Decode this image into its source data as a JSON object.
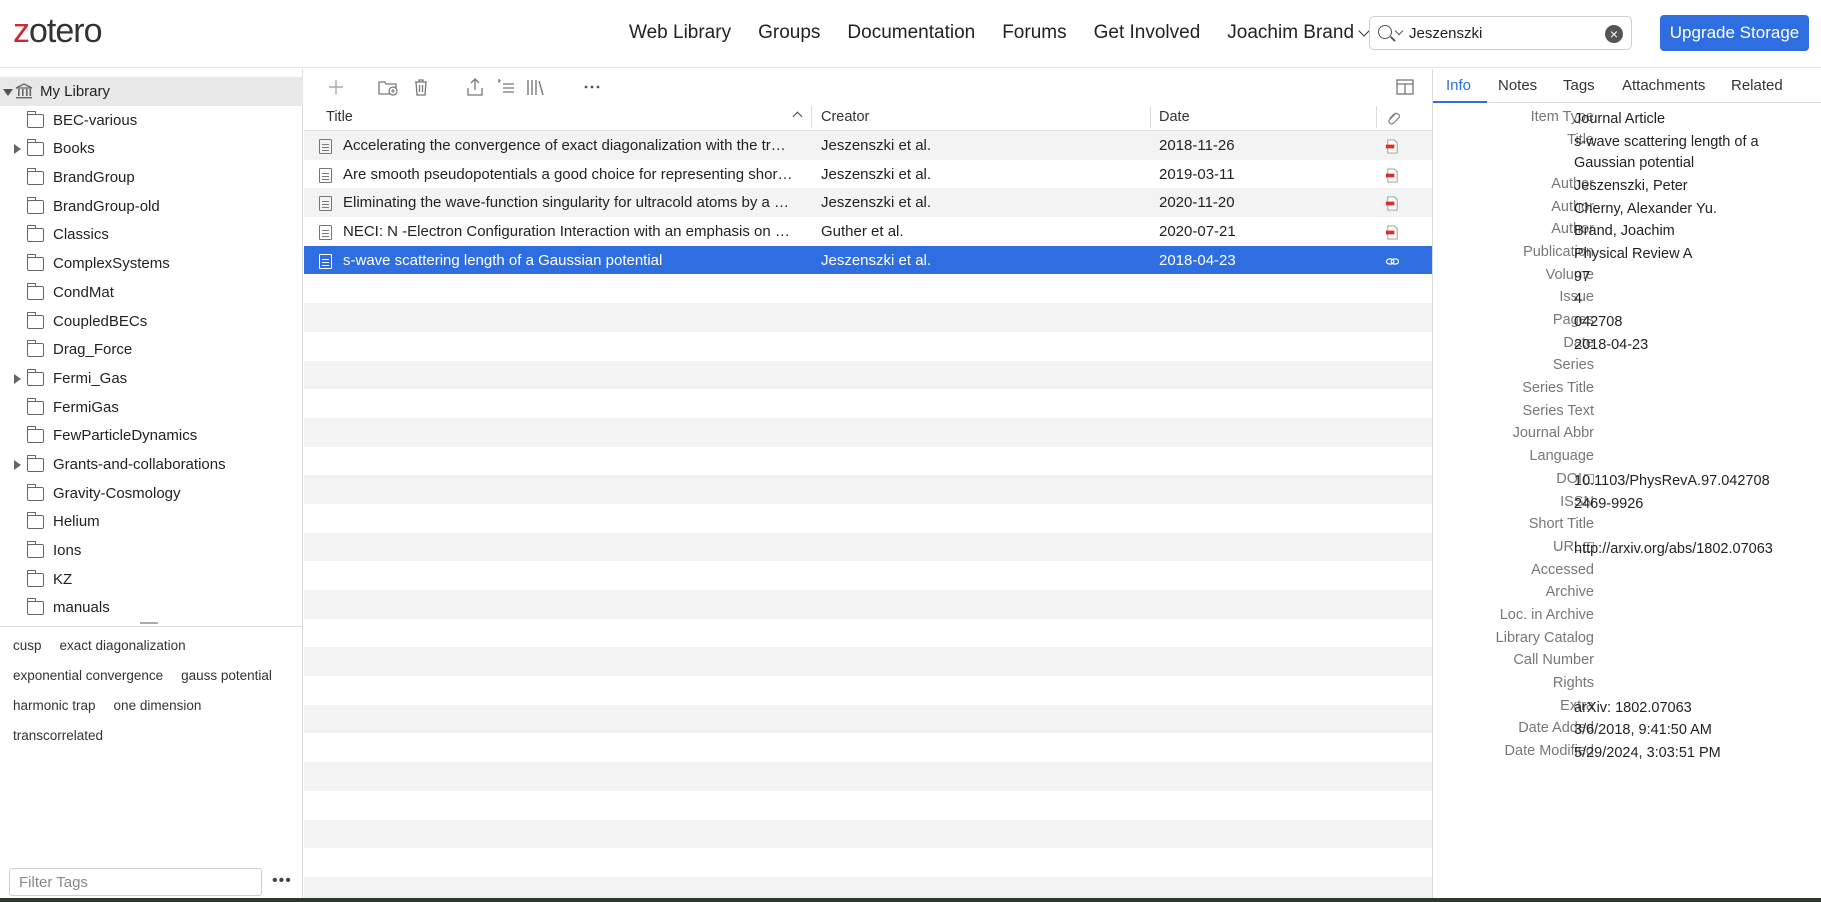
{
  "header": {
    "logo": "zotero",
    "nav": [
      "Web Library",
      "Groups",
      "Documentation",
      "Forums",
      "Get Involved"
    ],
    "user_name": "Joachim Brand",
    "search_value": "Jeszenszki",
    "upgrade_label": "Upgrade Storage"
  },
  "sidebar": {
    "root_label": "My Library",
    "collections": [
      {
        "label": "BEC-various",
        "expandable": false
      },
      {
        "label": "Books",
        "expandable": true
      },
      {
        "label": "BrandGroup",
        "expandable": false
      },
      {
        "label": "BrandGroup-old",
        "expandable": false
      },
      {
        "label": "Classics",
        "expandable": false
      },
      {
        "label": "ComplexSystems",
        "expandable": false
      },
      {
        "label": "CondMat",
        "expandable": false
      },
      {
        "label": "CoupledBECs",
        "expandable": false
      },
      {
        "label": "Drag_Force",
        "expandable": false
      },
      {
        "label": "Fermi_Gas",
        "expandable": true
      },
      {
        "label": "FermiGas",
        "expandable": false
      },
      {
        "label": "FewParticleDynamics",
        "expandable": false
      },
      {
        "label": "Grants-and-collaborations",
        "expandable": true
      },
      {
        "label": "Gravity-Cosmology",
        "expandable": false
      },
      {
        "label": "Helium",
        "expandable": false
      },
      {
        "label": "Ions",
        "expandable": false
      },
      {
        "label": "KZ",
        "expandable": false
      },
      {
        "label": "manuals",
        "expandable": false
      }
    ],
    "tags": [
      "cusp",
      "exact diagonalization",
      "exponential convergence",
      "gauss potential",
      "harmonic trap",
      "one dimension",
      "transcorrelated"
    ],
    "filter_placeholder": "Filter Tags",
    "more_label": "•••"
  },
  "toolbar": {
    "icons": [
      "add-icon",
      "new-collection-icon",
      "trash-icon",
      "export-icon",
      "citation-icon",
      "library-icon",
      "more-icon",
      "columns-icon"
    ]
  },
  "table": {
    "columns": {
      "title": "Title",
      "creator": "Creator",
      "date": "Date"
    },
    "rows": [
      {
        "title": "Accelerating the convergence of exact diagonalization with the transcorrelated method",
        "creator": "Jeszenszki et al.",
        "date": "2018-11-26",
        "attachment": "pdf"
      },
      {
        "title": "Are smooth pseudopotentials a good choice for representing short-range interactions?",
        "creator": "Jeszenszki et al.",
        "date": "2019-03-11",
        "attachment": "pdf"
      },
      {
        "title": "Eliminating the wave-function singularity for ultracold atoms by a similarity transformation",
        "creator": "Jeszenszki et al.",
        "date": "2020-11-20",
        "attachment": "pdf"
      },
      {
        "title": "NECI: N -Electron Configuration Interaction with an emphasis on state-of-the-art",
        "creator": "Guther et al.",
        "date": "2020-07-21",
        "attachment": "pdf"
      },
      {
        "title": "s-wave scattering length of a Gaussian potential",
        "creator": "Jeszenszki et al.",
        "date": "2018-04-23",
        "attachment": "link"
      }
    ],
    "selected_index": 4,
    "empty_rows": 22
  },
  "item_pane": {
    "tabs": [
      "Info",
      "Notes",
      "Tags",
      "Attachments",
      "Related"
    ],
    "active_tab": "Info",
    "fields": [
      {
        "k": "Item Type",
        "v": "Journal Article"
      },
      {
        "k": "Title",
        "v": "s-wave scattering length of a Gaussian potential",
        "lines": 2
      },
      {
        "k": "Author",
        "v": "Jeszenszki, Peter"
      },
      {
        "k": "Author",
        "v": "Cherny, Alexander Yu."
      },
      {
        "k": "Author",
        "v": "Brand, Joachim"
      },
      {
        "k": "Publication",
        "v": "Physical Review A"
      },
      {
        "k": "Volume",
        "v": "97"
      },
      {
        "k": "Issue",
        "v": "4"
      },
      {
        "k": "Pages",
        "v": "042708"
      },
      {
        "k": "Date",
        "v": "2018-04-23"
      },
      {
        "k": "Series",
        "v": ""
      },
      {
        "k": "Series Title",
        "v": ""
      },
      {
        "k": "Series Text",
        "v": ""
      },
      {
        "k": "Journal Abbr",
        "v": ""
      },
      {
        "k": "Language",
        "v": ""
      },
      {
        "k": "DOI",
        "v": "10.1103/PhysRevA.97.042708",
        "link": true
      },
      {
        "k": "ISSN",
        "v": "2469-9926"
      },
      {
        "k": "Short Title",
        "v": ""
      },
      {
        "k": "URL",
        "v": "http://arxiv.org/abs/1802.07063",
        "link": true
      },
      {
        "k": "Accessed",
        "v": ""
      },
      {
        "k": "Archive",
        "v": ""
      },
      {
        "k": "Loc. in Archive",
        "v": ""
      },
      {
        "k": "Library Catalog",
        "v": ""
      },
      {
        "k": "Call Number",
        "v": ""
      },
      {
        "k": "Rights",
        "v": ""
      },
      {
        "k": "Extra",
        "v": "arXiv: 1802.07063"
      },
      {
        "k": "Date Added",
        "v": "3/6/2018, 9:41:50 AM"
      },
      {
        "k": "Date Modified",
        "v": "5/29/2024, 3:03:51 PM"
      }
    ],
    "colors": {
      "accent": "#2e6ee0",
      "pdf": "#d9302c"
    }
  }
}
